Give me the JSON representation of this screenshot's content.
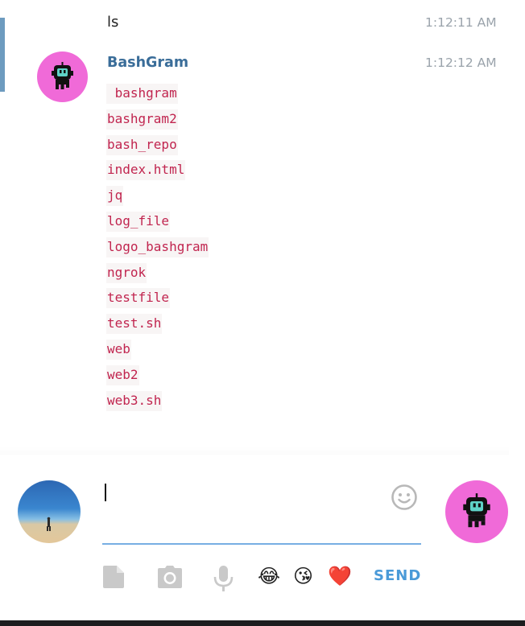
{
  "messages": [
    {
      "text": "ls",
      "time": "1:12:11 AM"
    },
    {
      "author": "BashGram",
      "time": "1:12:12 AM",
      "files": [
        " bashgram",
        "bashgram2",
        "bash_repo",
        "index.html",
        "jq",
        "log_file",
        "logo_bashgram",
        "ngrok",
        "testfile",
        "test.sh",
        "web",
        "web2",
        "web3.sh"
      ]
    }
  ],
  "composer": {
    "value": "",
    "emojis": [
      "😂",
      "😘",
      "❤️"
    ],
    "send_label": "SEND"
  },
  "icons": {
    "attach": "file-icon",
    "camera": "camera-icon",
    "mic": "microphone-icon",
    "emoji_picker": "smiley-icon",
    "bot": "robot-icon"
  },
  "colors": {
    "bot_avatar": "#f06ad8",
    "author": "#3a6d99",
    "code_text": "#c1254f",
    "send": "#4a9ad8",
    "input_underline": "#77aee3"
  }
}
